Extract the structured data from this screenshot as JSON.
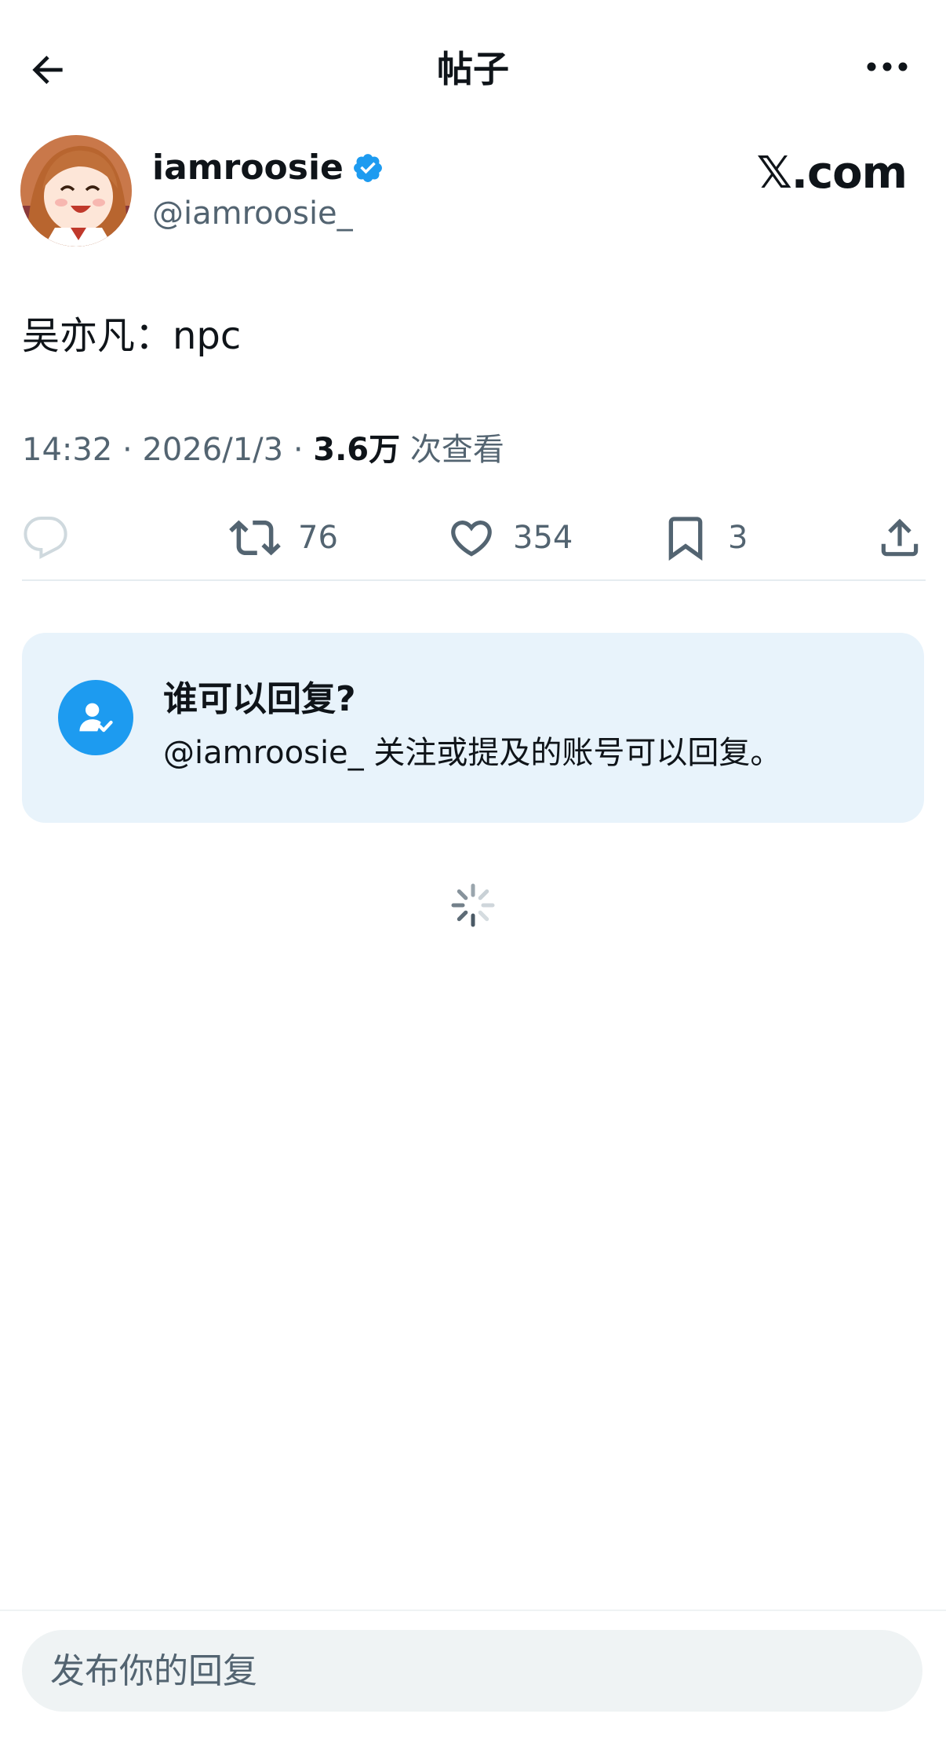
{
  "header": {
    "title": "帖子",
    "back_icon": "arrow-left-icon",
    "more_icon": "more-horizontal-icon"
  },
  "author": {
    "display_name": "iamroosie",
    "handle": "@iamroosie_",
    "verified_icon": "verified-badge-icon",
    "avatar": "anime-girl-avatar"
  },
  "brand": "𝕏.com",
  "post": {
    "text": "吴亦凡：npc",
    "time": "14:32",
    "date": "2026/1/3",
    "views_count": "3.6万",
    "views_label": "次查看",
    "separator": "·"
  },
  "actions": {
    "reply": {
      "icon": "reply-icon",
      "count": ""
    },
    "retweet": {
      "icon": "retweet-icon",
      "count": "76"
    },
    "like": {
      "icon": "heart-icon",
      "count": "354"
    },
    "bookmark": {
      "icon": "bookmark-icon",
      "count": "3"
    },
    "share": {
      "icon": "share-icon"
    }
  },
  "reply_settings": {
    "title": "谁可以回复?",
    "description": "@iamroosie_ 关注或提及的账号可以回复。",
    "icon": "user-check-icon"
  },
  "loading": {
    "icon": "loading-spinner-icon"
  },
  "composer": {
    "placeholder": "发布你的回复"
  },
  "colors": {
    "accent": "#1d9bf0",
    "text_primary": "#0f1419",
    "text_secondary": "#536471",
    "card_background": "#e8f3fb"
  }
}
